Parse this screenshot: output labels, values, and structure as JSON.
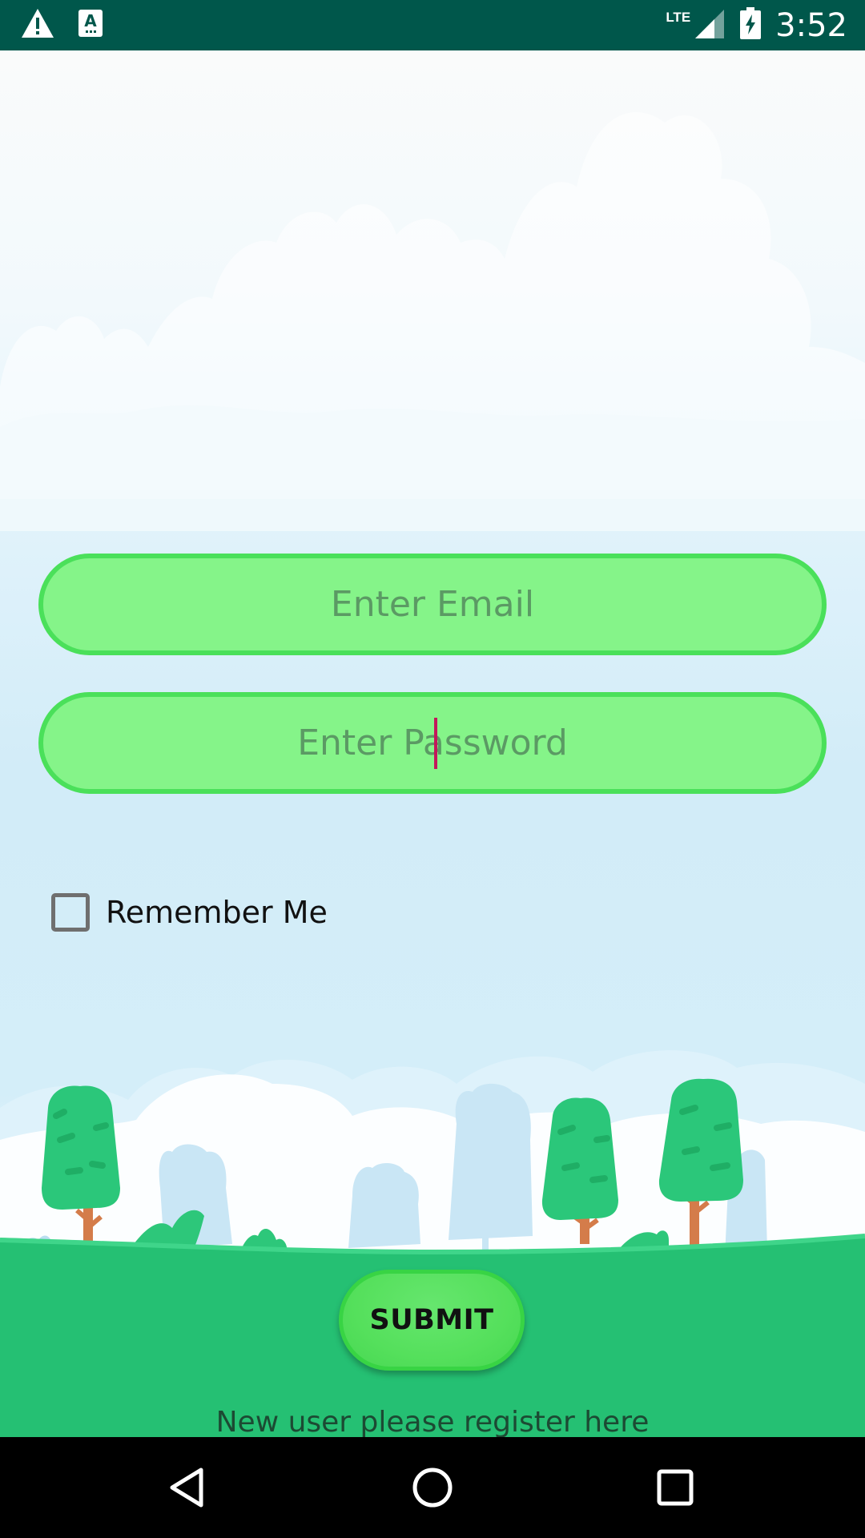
{
  "status_bar": {
    "network_type": "LTE",
    "time": "3:52",
    "icons": [
      "warning-icon",
      "text-a-icon",
      "signal-icon",
      "battery-charging-icon"
    ]
  },
  "form": {
    "email_placeholder": "Enter Email",
    "password_placeholder": "Enter Password",
    "remember_label": "Remember Me",
    "remember_checked": false,
    "submit_label": "SUBMIT",
    "register_text": "New user please register here"
  },
  "nav_bar": {
    "icons": [
      "back-icon",
      "home-icon",
      "recents-icon"
    ]
  },
  "colors": {
    "status_bar_bg": "#00574b",
    "field_fill": "#85f489",
    "field_border": "#4ae05a",
    "ground": "#25c073",
    "caret": "#c2185b"
  }
}
